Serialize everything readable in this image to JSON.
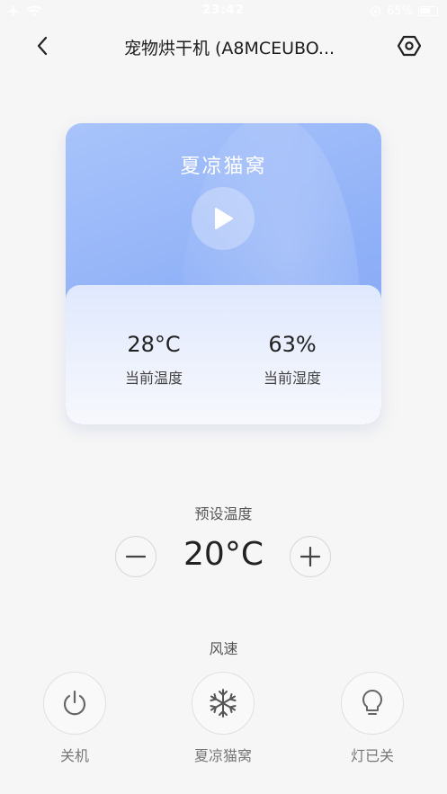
{
  "status_bar": {
    "time": "23:42",
    "battery": "65%"
  },
  "nav": {
    "title": "宠物烘干机 (A8MCEUBO...",
    "back_icon": "chevron-left-icon",
    "settings_icon": "settings-hex-icon"
  },
  "card": {
    "mode_name": "夏凉猫窝",
    "current_temperature": {
      "value": "28°C",
      "label": "当前温度"
    },
    "current_humidity": {
      "value": "63%",
      "label": "当前湿度"
    },
    "colors": {
      "top": "#a9c4fb",
      "bottom": "#86a8f5"
    }
  },
  "preset": {
    "label": "预设温度",
    "value": "20°C"
  },
  "wind": {
    "label": "风速",
    "controls": [
      {
        "label": "关机",
        "icon": "power-icon"
      },
      {
        "label": "夏凉猫窝",
        "icon": "snowflake-icon"
      },
      {
        "label": "灯已关",
        "icon": "bulb-icon"
      }
    ]
  }
}
